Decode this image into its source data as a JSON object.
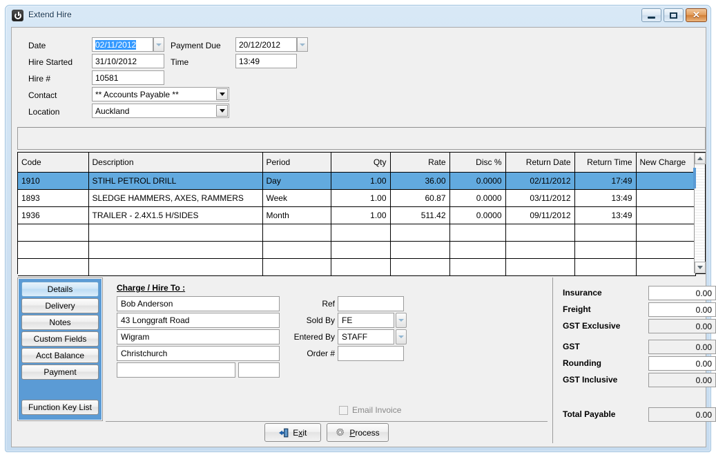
{
  "window": {
    "title": "Extend Hire",
    "icon": "power-icon",
    "controls": {
      "minimize": "minimize-icon",
      "maximize": "maximize-icon",
      "close": "close-icon"
    }
  },
  "form": {
    "date_label": "Date",
    "date_value": "02/11/2012",
    "hire_started_label": "Hire Started",
    "hire_started_value": "31/10/2012",
    "hire_no_label": "Hire #",
    "hire_no_value": "10581",
    "contact_label": "Contact",
    "contact_value": "** Accounts Payable **",
    "location_label": "Location",
    "location_value": "Auckland",
    "payment_due_label": "Payment Due",
    "payment_due_value": "20/12/2012",
    "time_label": "Time",
    "time_value": "13:49"
  },
  "grid": {
    "columns": [
      "Code",
      "Description",
      "Period",
      "Qty",
      "Rate",
      "Disc %",
      "Return Date",
      "Return Time",
      "New Charge"
    ],
    "rows": [
      {
        "code": "1910",
        "description": "STIHL PETROL DRILL",
        "period": "Day",
        "qty": "1.00",
        "rate": "36.00",
        "disc": "0.0000",
        "return_date": "02/11/2012",
        "return_time": "17:49",
        "new_charge": "",
        "selected": true
      },
      {
        "code": "1893",
        "description": "SLEDGE HAMMERS, AXES, RAMMERS",
        "period": "Week",
        "qty": "1.00",
        "rate": "60.87",
        "disc": "0.0000",
        "return_date": "03/11/2012",
        "return_time": "13:49",
        "new_charge": "",
        "selected": false
      },
      {
        "code": "1936",
        "description": "TRAILER - 2.4X1.5 H/SIDES",
        "period": "Month",
        "qty": "1.00",
        "rate": "511.42",
        "disc": "0.0000",
        "return_date": "09/11/2012",
        "return_time": "13:49",
        "new_charge": "",
        "selected": false
      },
      {
        "code": "",
        "description": "",
        "period": "",
        "qty": "",
        "rate": "",
        "disc": "",
        "return_date": "",
        "return_time": "",
        "new_charge": "",
        "selected": false
      },
      {
        "code": "",
        "description": "",
        "period": "",
        "qty": "",
        "rate": "",
        "disc": "",
        "return_date": "",
        "return_time": "",
        "new_charge": "",
        "selected": false
      },
      {
        "code": "",
        "description": "",
        "period": "",
        "qty": "",
        "rate": "",
        "disc": "",
        "return_date": "",
        "return_time": "",
        "new_charge": "",
        "selected": false
      }
    ]
  },
  "side_buttons": [
    {
      "label": "Details",
      "active": true
    },
    {
      "label": "Delivery",
      "active": false
    },
    {
      "label": "Notes",
      "active": false
    },
    {
      "label": "Custom Fields",
      "active": false
    },
    {
      "label": "Acct Balance",
      "active": false
    },
    {
      "label": "Payment",
      "active": false
    },
    {
      "label": "Function Key List",
      "active": false
    }
  ],
  "charge": {
    "title": "Charge / Hire To :",
    "name": "Bob Anderson",
    "address1": "43 Longgraft Road",
    "address2": "Wigram",
    "address3": "Christchurch",
    "address4": "",
    "postcode": "",
    "ref_label": "Ref",
    "ref_value": "",
    "sold_by_label": "Sold By",
    "sold_by_value": "FE",
    "entered_by_label": "Entered By",
    "entered_by_value": "STAFF",
    "order_no_label": "Order #",
    "order_no_value": ""
  },
  "email_invoice": {
    "label": "Email Invoice",
    "checked": false
  },
  "actions": {
    "exit_label": "Exit",
    "exit_icon": "exit-door-icon",
    "process_label": "Process",
    "process_icon": "gear-icon"
  },
  "totals": [
    {
      "label": "Insurance",
      "value": "0.00",
      "readonly": false
    },
    {
      "label": "Freight",
      "value": "0.00",
      "readonly": false
    },
    {
      "label": "GST Exclusive",
      "value": "0.00",
      "readonly": true
    },
    {
      "label": "GST",
      "value": "0.00",
      "readonly": true
    },
    {
      "label": "Rounding",
      "value": "0.00",
      "readonly": false
    },
    {
      "label": "GST Inclusive",
      "value": "0.00",
      "readonly": true
    },
    {
      "label": "Total Payable",
      "value": "0.00",
      "readonly": true
    }
  ],
  "colors": {
    "selection": "#62aadf",
    "side_panel": "#5b9bd5",
    "frame": "#cfe2f3",
    "close_button": "#d07f37"
  }
}
